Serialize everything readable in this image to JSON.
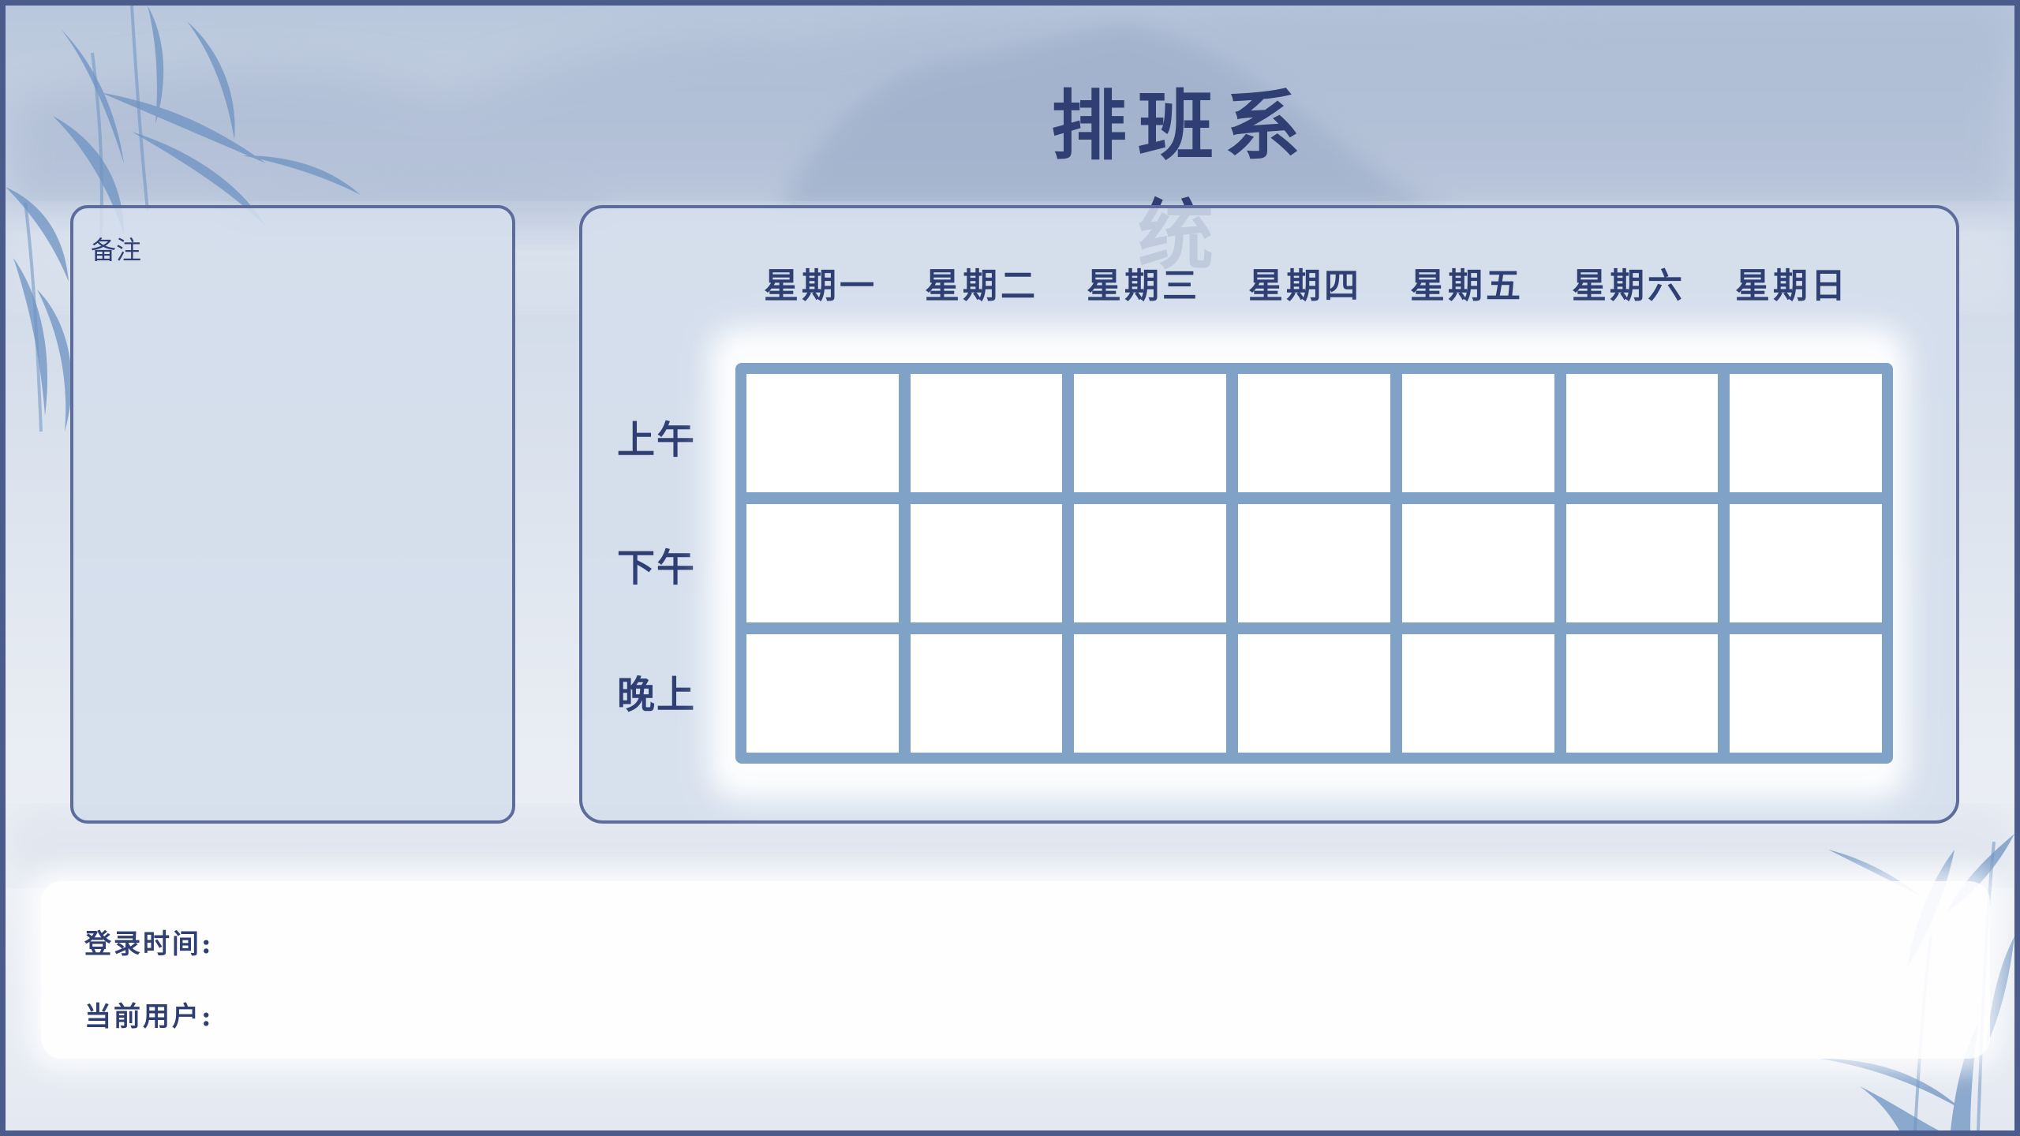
{
  "app": {
    "title": "排班系统"
  },
  "notes": {
    "label": "备注"
  },
  "schedule": {
    "days": [
      "星期一",
      "星期二",
      "星期三",
      "星期四",
      "星期五",
      "星期六",
      "星期日"
    ],
    "periods": [
      "上午",
      "下午",
      "晚上"
    ],
    "cells": [
      [
        "",
        "",
        "",
        "",
        "",
        "",
        ""
      ],
      [
        "",
        "",
        "",
        "",
        "",
        "",
        ""
      ],
      [
        "",
        "",
        "",
        "",
        "",
        "",
        ""
      ]
    ]
  },
  "footer": {
    "login_time_label": "登录时间:",
    "login_time_value": "",
    "current_user_label": "当前用户:",
    "current_user_value": ""
  },
  "theme": {
    "border": "#4a5b8c",
    "text": "#2f3f73",
    "grid": "#7fa2c6",
    "panel": "#d4deec"
  }
}
